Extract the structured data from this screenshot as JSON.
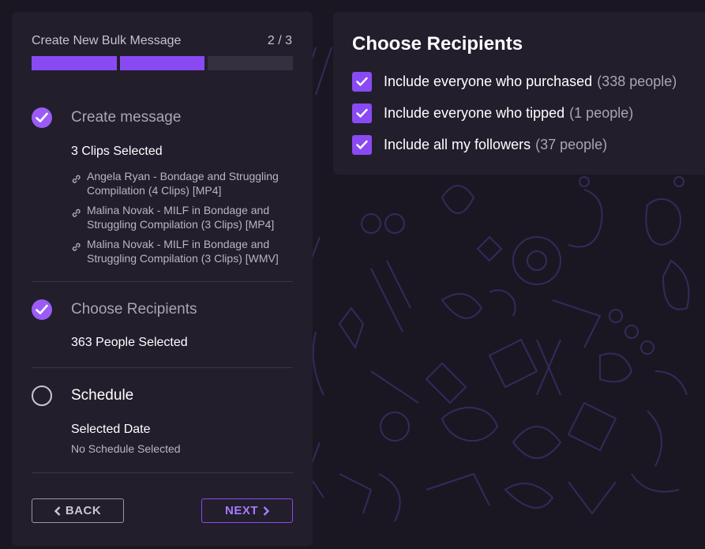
{
  "wizard": {
    "title": "Create New Bulk Message",
    "step_indicator": "2 / 3",
    "progress": {
      "total_steps": 3,
      "completed_steps": 2
    },
    "steps": [
      {
        "title": "Create message",
        "status": "done",
        "summary": "3 Clips Selected",
        "clips": [
          "Angela Ryan - Bondage and Struggling Compilation (4 Clips) [MP4]",
          "Malina Novak - MILF in Bondage and Struggling Compilation (3 Clips) [MP4]",
          "Malina Novak - MILF in Bondage and Struggling Compilation (3 Clips) [WMV]"
        ]
      },
      {
        "title": "Choose Recipients",
        "status": "done",
        "summary": "363 People Selected"
      },
      {
        "title": "Schedule",
        "status": "todo",
        "summary": "Selected Date",
        "detail": "No Schedule Selected"
      }
    ],
    "back_label": "BACK",
    "next_label": "NEXT"
  },
  "recipients": {
    "title": "Choose Recipients",
    "options": [
      {
        "label": "Include everyone who purchased",
        "count": "(338 people)",
        "checked": true
      },
      {
        "label": "Include everyone who tipped",
        "count": "(1 people)",
        "checked": true
      },
      {
        "label": "Include all my followers",
        "count": "(37 people)",
        "checked": true
      }
    ]
  },
  "colors": {
    "accent": "#8a4af3",
    "background": "#1a1722",
    "panel": "#221e2c",
    "pattern": "#3c2a63"
  },
  "icons": {
    "step_done": "check-circle-icon",
    "step_todo": "empty-circle-icon",
    "clip": "link-icon",
    "back": "chevron-left-icon",
    "next": "chevron-right-icon",
    "checkbox": "check-icon"
  }
}
